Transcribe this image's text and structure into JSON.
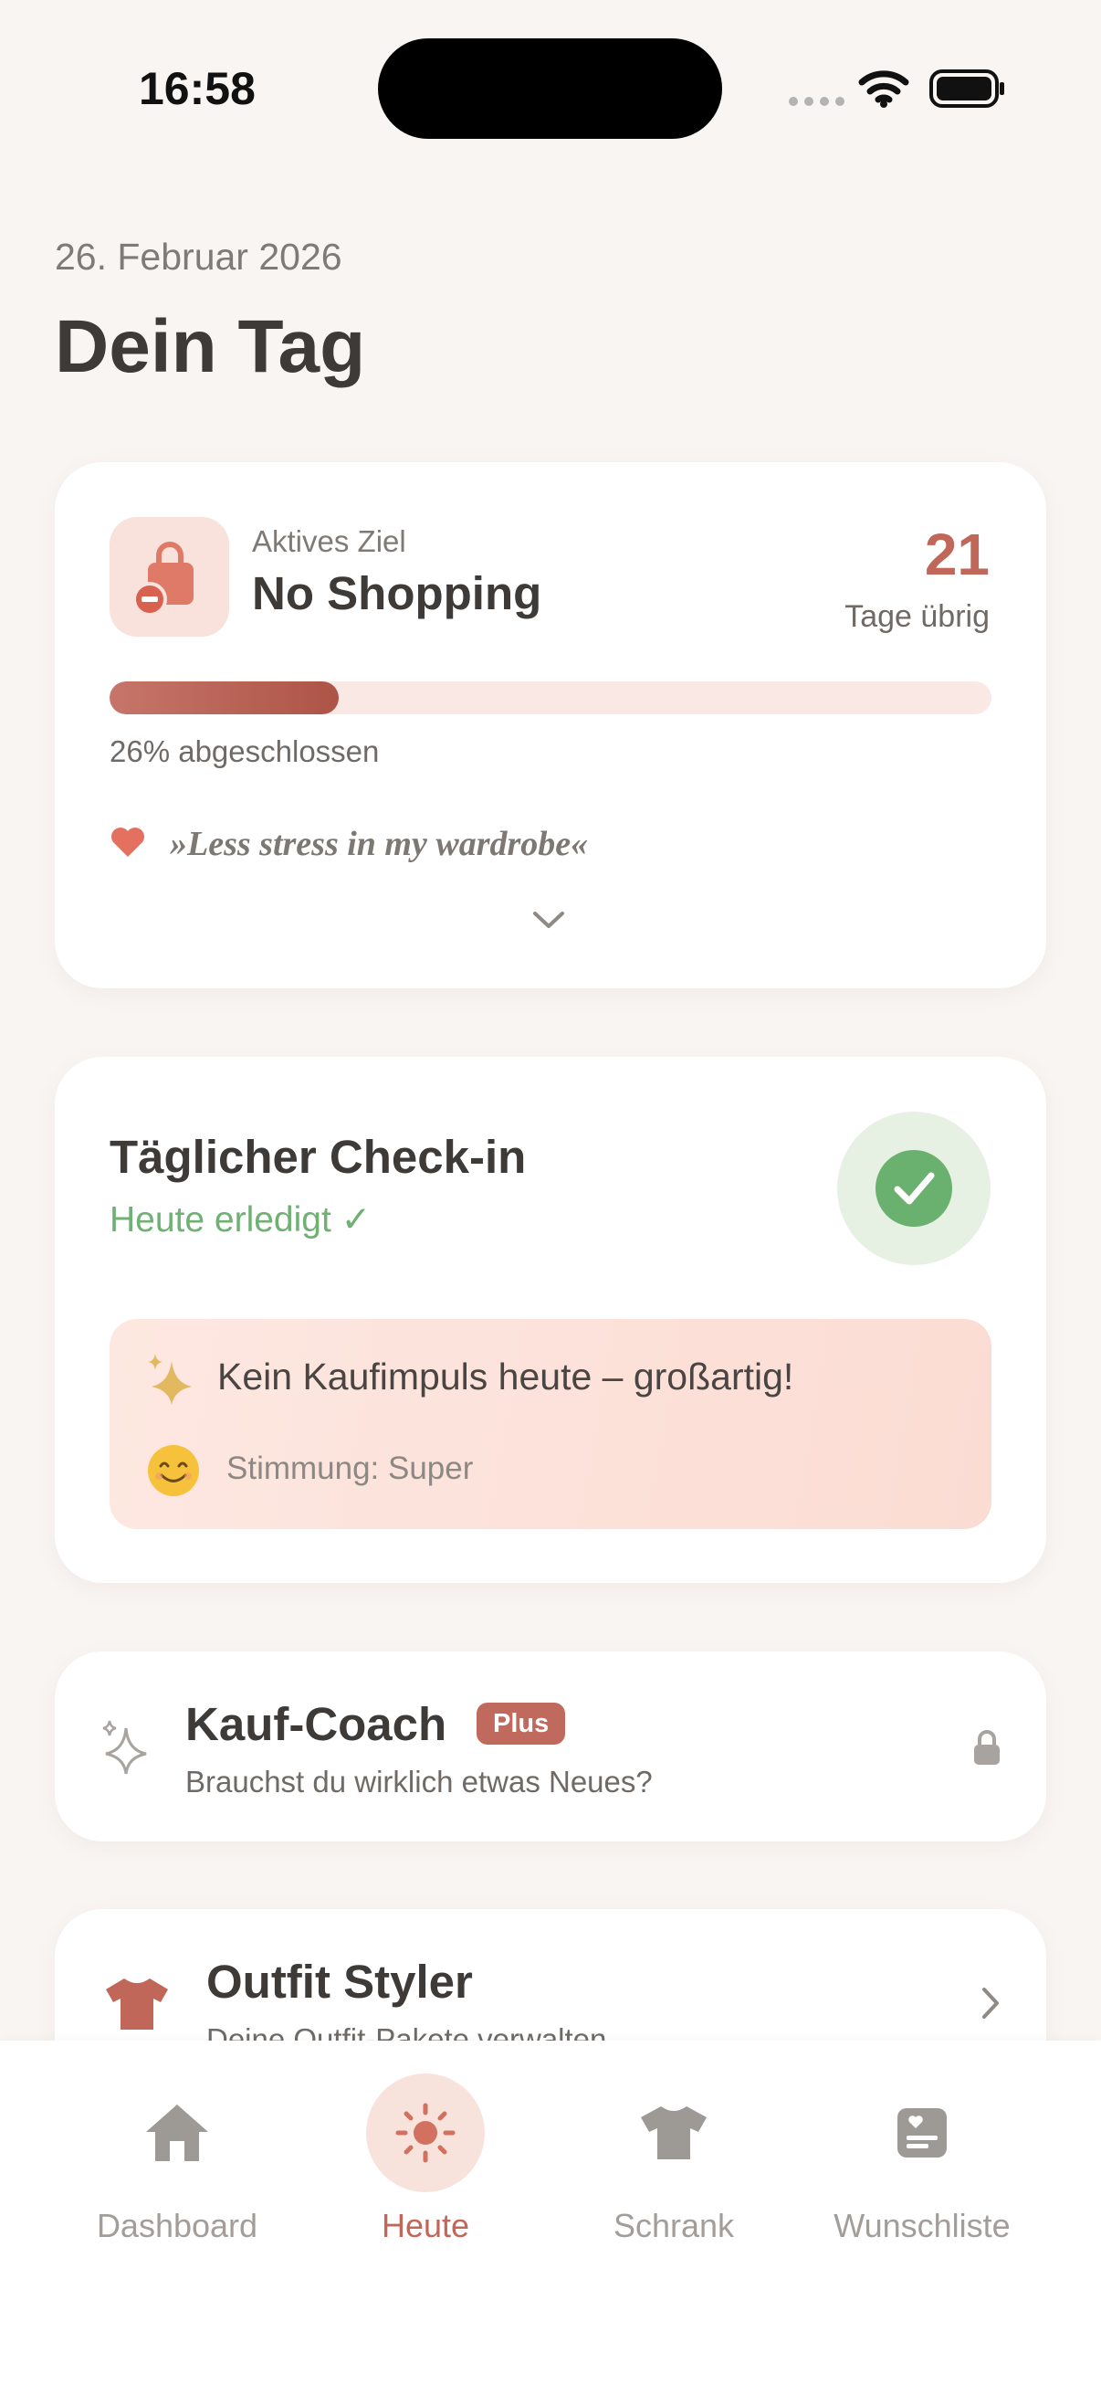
{
  "status_bar": {
    "time": "16:58"
  },
  "header": {
    "date": "26. Februar 2026",
    "title": "Dein Tag"
  },
  "goal_card": {
    "label": "Aktives Ziel",
    "name": "No Shopping",
    "days_left": "21",
    "days_left_label": "Tage übrig",
    "progress_percent": 26,
    "progress_text": "26% abgeschlossen",
    "quote": "»Less stress in my wardrobe«",
    "accent_color": "#c0675a"
  },
  "checkin_card": {
    "title": "Täglicher Check-in",
    "status": "Heute erledigt ✓",
    "impulse_text": "Kein Kaufimpuls heute – großartig!",
    "mood_text": "Stimmung: Super",
    "status_color": "#6fb172"
  },
  "coach_card": {
    "title": "Kauf-Coach",
    "badge": "Plus",
    "subtitle": "Brauchst du wirklich etwas Neues?"
  },
  "styler_card": {
    "title": "Outfit Styler",
    "subtitle": "Deine Outfit-Pakete verwalten"
  },
  "tabbar": {
    "tabs": [
      {
        "label": "Dashboard",
        "icon": "house-icon"
      },
      {
        "label": "Heute",
        "icon": "sun-icon",
        "active": true
      },
      {
        "label": "Schrank",
        "icon": "tshirt-icon"
      },
      {
        "label": "Wunschliste",
        "icon": "wishlist-icon"
      }
    ]
  }
}
